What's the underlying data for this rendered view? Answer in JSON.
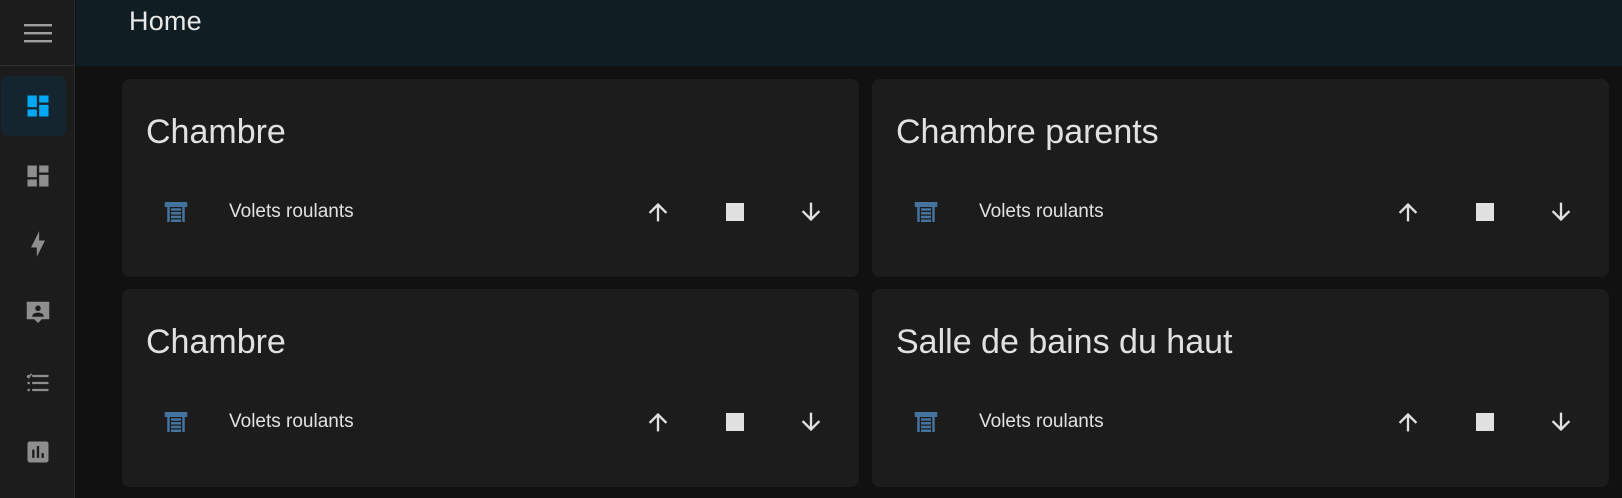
{
  "header": {
    "title": "Home"
  },
  "sidebar": {
    "menu_icon": "menu-icon",
    "items": [
      {
        "icon": "view-dashboard-icon",
        "active": true
      },
      {
        "icon": "view-dashboard-variant-icon",
        "active": false
      },
      {
        "icon": "lightning-bolt-icon",
        "active": false
      },
      {
        "icon": "account-box-icon",
        "active": false
      },
      {
        "icon": "format-list-checks-icon",
        "active": false
      },
      {
        "icon": "chart-box-icon",
        "active": false
      }
    ]
  },
  "cards": [
    {
      "title": "Chambre",
      "entity": {
        "name": "Volets roulants",
        "icon": "window-shutter-icon"
      }
    },
    {
      "title": "Chambre parents",
      "entity": {
        "name": "Volets roulants",
        "icon": "window-shutter-icon"
      }
    },
    {
      "title": "Chambre",
      "entity": {
        "name": "Volets roulants",
        "icon": "window-shutter-icon"
      }
    },
    {
      "title": "Salle de bains du haut",
      "entity": {
        "name": "Volets roulants",
        "icon": "window-shutter-icon"
      }
    }
  ],
  "controls": {
    "up_icon": "arrow-up-icon",
    "stop_icon": "stop-icon",
    "down_icon": "arrow-down-icon"
  },
  "colors": {
    "accent": "#03a9f4",
    "shutter_icon": "#44739e",
    "card_background": "#1c1c1c",
    "header_background": "#101e24",
    "page_background": "#111111"
  }
}
